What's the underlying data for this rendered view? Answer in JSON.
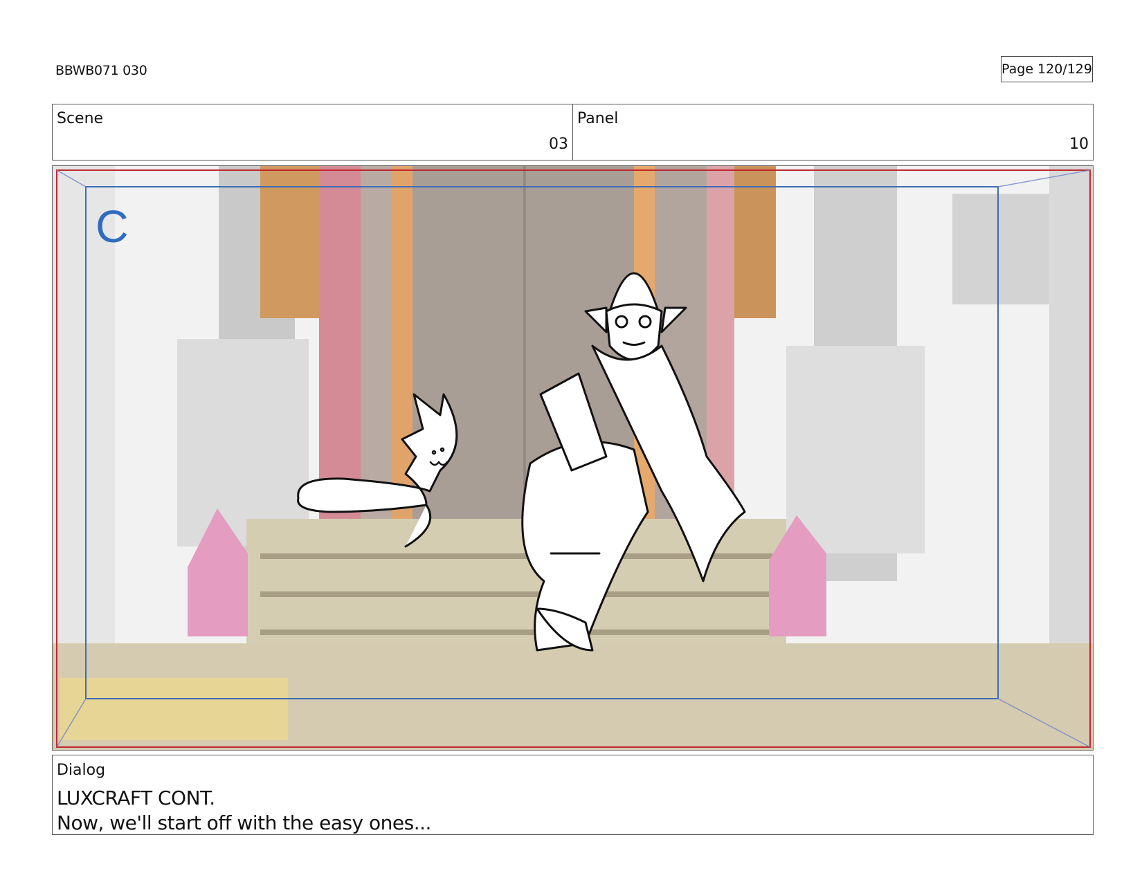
{
  "header": {
    "doc_id": "BBWB071 030",
    "page": "Page 120/129"
  },
  "info": {
    "scene_label": "Scene",
    "scene_value": "03",
    "panel_label": "Panel",
    "panel_value": "10"
  },
  "frame": {
    "camera_letter": "C"
  },
  "dialog": {
    "label": "Dialog",
    "lines": [
      "LUXCRAFT CONT.",
      "Now, we'll start off with the easy ones..."
    ]
  },
  "colors": {
    "safe_frame_red": "#c0282f",
    "safe_frame_blue": "#3c6db5",
    "letter_blue": "#2f6bc1"
  }
}
